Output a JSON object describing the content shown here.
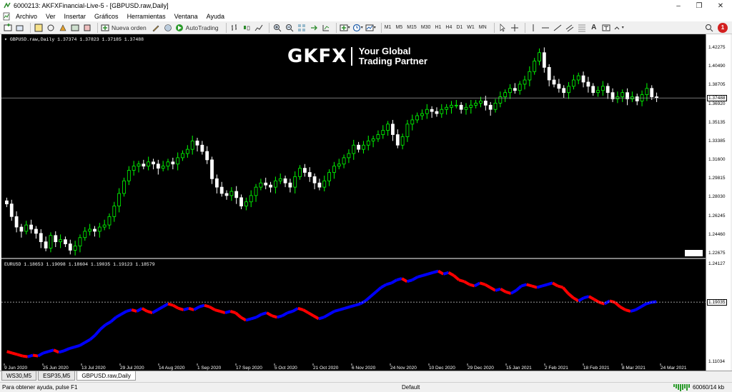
{
  "window": {
    "title": "6000213: AKFXFinancial-Live-5 - [GBPUSD.raw,Daily]"
  },
  "menu": [
    "Archivo",
    "Ver",
    "Insertar",
    "Gráficos",
    "Herramientas",
    "Ventana",
    "Ayuda"
  ],
  "toolbar": {
    "new_order_label": "Nueva orden",
    "autotrading_label": "AutoTrading",
    "timeframes": [
      "M1",
      "M5",
      "M15",
      "M30",
      "H1",
      "H4",
      "D1",
      "W1",
      "MN"
    ],
    "notification_count": "1"
  },
  "logo": {
    "mark": "GKFX",
    "tagline_1": "Your Global",
    "tagline_2": "Trading Partner"
  },
  "chart_data": [
    {
      "type": "candlestick",
      "symbol_info": "GBPUSD.raw,Daily  1.37374 1.37823 1.37185 1.37488",
      "ylim": [
        1.2228,
        1.4355
      ],
      "ticks": [
        "1.42275",
        "1.40490",
        "1.38705",
        "1.36920",
        "1.35135",
        "1.33385",
        "1.31600",
        "1.29815",
        "1.28030",
        "1.26245",
        "1.24460",
        "1.22675"
      ],
      "current_price": "1.37488",
      "close": [
        1.274,
        1.262,
        1.252,
        1.248,
        1.254,
        1.25,
        1.246,
        1.238,
        1.232,
        1.244,
        1.238,
        1.24,
        1.236,
        1.23,
        1.234,
        1.242,
        1.248,
        1.25,
        1.248,
        1.252,
        1.254,
        1.262,
        1.272,
        1.284,
        1.296,
        1.306,
        1.31,
        1.312,
        1.31,
        1.314,
        1.312,
        1.308,
        1.31,
        1.314,
        1.312,
        1.318,
        1.322,
        1.326,
        1.334,
        1.33,
        1.324,
        1.316,
        1.298,
        1.29,
        1.284,
        1.282,
        1.286,
        1.28,
        1.272,
        1.276,
        1.282,
        1.29,
        1.294,
        1.292,
        1.29,
        1.296,
        1.298,
        1.294,
        1.29,
        1.3,
        1.308,
        1.304,
        1.3,
        1.294,
        1.29,
        1.296,
        1.304,
        1.31,
        1.312,
        1.318,
        1.322,
        1.33,
        1.326,
        1.33,
        1.334,
        1.336,
        1.34,
        1.344,
        1.35,
        1.34,
        1.33,
        1.338,
        1.35,
        1.354,
        1.358,
        1.36,
        1.364,
        1.362,
        1.36,
        1.364,
        1.366,
        1.368,
        1.368,
        1.364,
        1.366,
        1.368,
        1.37,
        1.372,
        1.368,
        1.364,
        1.37,
        1.376,
        1.38,
        1.384,
        1.382,
        1.388,
        1.392,
        1.4,
        1.41,
        1.418,
        1.404,
        1.392,
        1.388,
        1.384,
        1.38,
        1.386,
        1.392,
        1.396,
        1.39,
        1.386,
        1.38,
        1.382,
        1.386,
        1.38,
        1.374,
        1.376,
        1.38,
        1.374,
        1.376,
        1.372,
        1.378,
        1.384,
        1.376,
        1.375
      ]
    },
    {
      "type": "line",
      "symbol_info": "EURUSD  1.18653 1.19098 1.18604 1.19035 1.19123 1.18579",
      "ylim": [
        1.108,
        1.247
      ],
      "ticks": [
        "1.24127",
        "1.19035",
        "1.11034"
      ],
      "current_price": "1.19035",
      "close": [
        1.124,
        1.122,
        1.12,
        1.118,
        1.117,
        1.119,
        1.118,
        1.122,
        1.124,
        1.126,
        1.123,
        1.125,
        1.128,
        1.13,
        1.132,
        1.136,
        1.14,
        1.146,
        1.154,
        1.16,
        1.164,
        1.17,
        1.174,
        1.178,
        1.18,
        1.178,
        1.182,
        1.178,
        1.176,
        1.18,
        1.184,
        1.188,
        1.186,
        1.182,
        1.18,
        1.182,
        1.18,
        1.184,
        1.186,
        1.184,
        1.18,
        1.178,
        1.176,
        1.178,
        1.176,
        1.17,
        1.166,
        1.168,
        1.17,
        1.174,
        1.176,
        1.172,
        1.17,
        1.172,
        1.176,
        1.178,
        1.182,
        1.18,
        1.176,
        1.172,
        1.168,
        1.17,
        1.174,
        1.178,
        1.18,
        1.182,
        1.184,
        1.186,
        1.188,
        1.192,
        1.198,
        1.204,
        1.21,
        1.214,
        1.216,
        1.22,
        1.222,
        1.218,
        1.22,
        1.224,
        1.226,
        1.228,
        1.23,
        1.232,
        1.228,
        1.23,
        1.226,
        1.22,
        1.218,
        1.214,
        1.212,
        1.216,
        1.214,
        1.21,
        1.206,
        1.208,
        1.204,
        1.202,
        1.206,
        1.212,
        1.214,
        1.212,
        1.21,
        1.212,
        1.214,
        1.216,
        1.212,
        1.21,
        1.202,
        1.196,
        1.192,
        1.196,
        1.198,
        1.194,
        1.19,
        1.188,
        1.192,
        1.19,
        1.184,
        1.18,
        1.178,
        1.18,
        1.184,
        1.188,
        1.19,
        1.191
      ]
    }
  ],
  "x_axis_labels": [
    "9 Jun 2020",
    "25 Jun 2020",
    "13 Jul 2020",
    "29 Jul 2020",
    "14 Aug 2020",
    "1 Sep 2020",
    "17 Sep 2020",
    "5 Oct 2020",
    "21 Oct 2020",
    "6 Nov 2020",
    "24 Nov 2020",
    "10 Dec 2020",
    "29 Dec 2020",
    "15 Jan 2021",
    "2 Feb 2021",
    "18 Feb 2021",
    "8 Mar 2021",
    "24 Mar 2021"
  ],
  "tabs": [
    "WS30,M5",
    "ESP35,M5",
    "GBPUSD.raw,Daily"
  ],
  "status": {
    "help": "Para obtener ayuda, pulse F1",
    "profile": "Default",
    "traffic": "60060/14 kb"
  },
  "colors": {
    "bull": "#00ff00",
    "bear": "#ffffff",
    "line_up": "#0000ff",
    "line_down": "#ff0000"
  }
}
